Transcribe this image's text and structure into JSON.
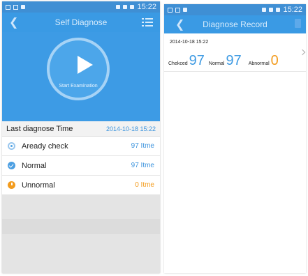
{
  "left_screen": {
    "status_time": "15:22",
    "title": "Self Diagnose",
    "back_icon": "chevron-left-icon",
    "menu_icon": "list-menu-icon",
    "start_label": "Start Examination",
    "last_diagnose": {
      "label": "Last diagnose Time",
      "value": "2014-10-18 15:22"
    },
    "items": [
      {
        "label": "Aready check",
        "value": "97 Itme",
        "icon": "check-circle-icon",
        "color": "#3d94dd"
      },
      {
        "label": "Normal",
        "value": "97 Itme",
        "icon": "check-icon",
        "color": "#3d94dd"
      },
      {
        "label": "Unnormal",
        "value": "0 Itme",
        "icon": "alert-circle-icon",
        "color": "#f39c1e"
      }
    ]
  },
  "right_screen": {
    "status_time": "15:22",
    "title": "Diagnose Record",
    "back_icon": "chevron-left-icon",
    "trash_icon": "trash-icon",
    "record": {
      "date": "2014-10-18 15:22",
      "checked_label": "Chekced",
      "checked_value": "97",
      "normal_label": "Normal",
      "normal_value": "97",
      "abnormal_label": "Abnormal",
      "abnormal_value": "0"
    }
  }
}
